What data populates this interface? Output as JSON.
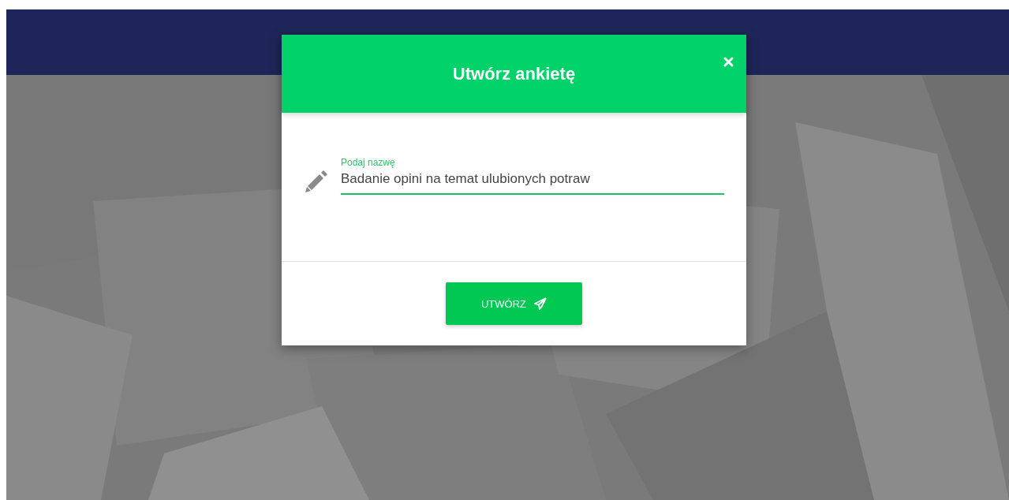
{
  "modal": {
    "title": "Utwórz ankietę",
    "field": {
      "label": "Podaj nazwę",
      "value": "Badanie opini na temat ulubionych potraw"
    },
    "button": {
      "label": "UTWÓRZ"
    }
  }
}
